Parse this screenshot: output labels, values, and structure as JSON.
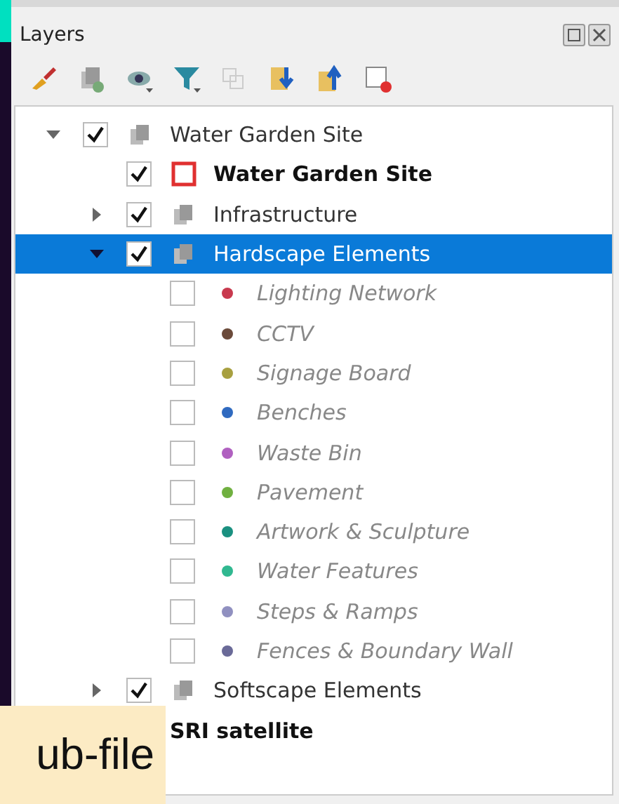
{
  "panel": {
    "title": "Layers"
  },
  "tree": [
    {
      "label": "Water Garden Site",
      "kind": "group",
      "checked": true,
      "expanded": true,
      "selected": false,
      "children": [
        {
          "label": "Water Garden Site",
          "kind": "polygon",
          "checked": true,
          "selected": false,
          "color": "#e03030"
        },
        {
          "label": "Infrastructure",
          "kind": "group",
          "checked": true,
          "expanded": false,
          "selected": false
        },
        {
          "label": "Hardscape Elements",
          "kind": "group",
          "checked": true,
          "expanded": true,
          "selected": true,
          "children": [
            {
              "label": "Lighting Network",
              "kind": "point",
              "checked": false,
              "selected": false,
              "color": "#c8394e"
            },
            {
              "label": "CCTV",
              "kind": "point",
              "checked": false,
              "selected": false,
              "color": "#6b4a3a"
            },
            {
              "label": "Signage Board",
              "kind": "point",
              "checked": false,
              "selected": false,
              "color": "#a8a040"
            },
            {
              "label": "Benches",
              "kind": "point",
              "checked": false,
              "selected": false,
              "color": "#2f6ac0"
            },
            {
              "label": "Waste Bin",
              "kind": "point",
              "checked": false,
              "selected": false,
              "color": "#b060c0"
            },
            {
              "label": "Pavement",
              "kind": "point",
              "checked": false,
              "selected": false,
              "color": "#70b040"
            },
            {
              "label": "Artwork & Sculpture",
              "kind": "point",
              "checked": false,
              "selected": false,
              "color": "#1a9080"
            },
            {
              "label": "Water Features",
              "kind": "point",
              "checked": false,
              "selected": false,
              "color": "#30b890"
            },
            {
              "label": "Steps & Ramps",
              "kind": "point",
              "checked": false,
              "selected": false,
              "color": "#9090c0"
            },
            {
              "label": "Fences & Boundary Wall",
              "kind": "point",
              "checked": false,
              "selected": false,
              "color": "#6a6a98"
            }
          ]
        },
        {
          "label": "Softscape Elements",
          "kind": "group",
          "checked": true,
          "expanded": false,
          "selected": false
        }
      ]
    },
    {
      "label": "SRI satellite",
      "kind": "raster",
      "selected": false
    }
  ],
  "caption": {
    "text": "ub-file"
  }
}
